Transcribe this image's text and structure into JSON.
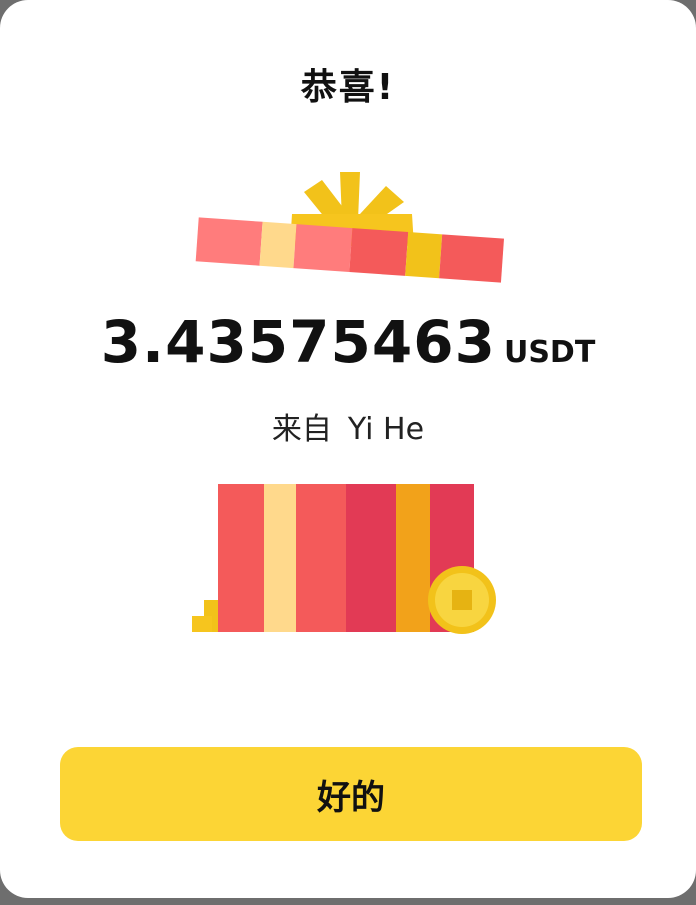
{
  "dialog": {
    "title": "恭喜!",
    "amount": "3.43575463",
    "unit": "USDT",
    "from_label": "来自",
    "sender_name": "Yi He",
    "ok_label": "好的"
  },
  "colors": {
    "button": "#fcd535",
    "gold": "#f2c21a",
    "red": "#f45a5a",
    "pink": "#ff7c7c",
    "crimson": "#e23a55",
    "cream": "#ffd98c",
    "overlay": "#6e6e6e"
  }
}
